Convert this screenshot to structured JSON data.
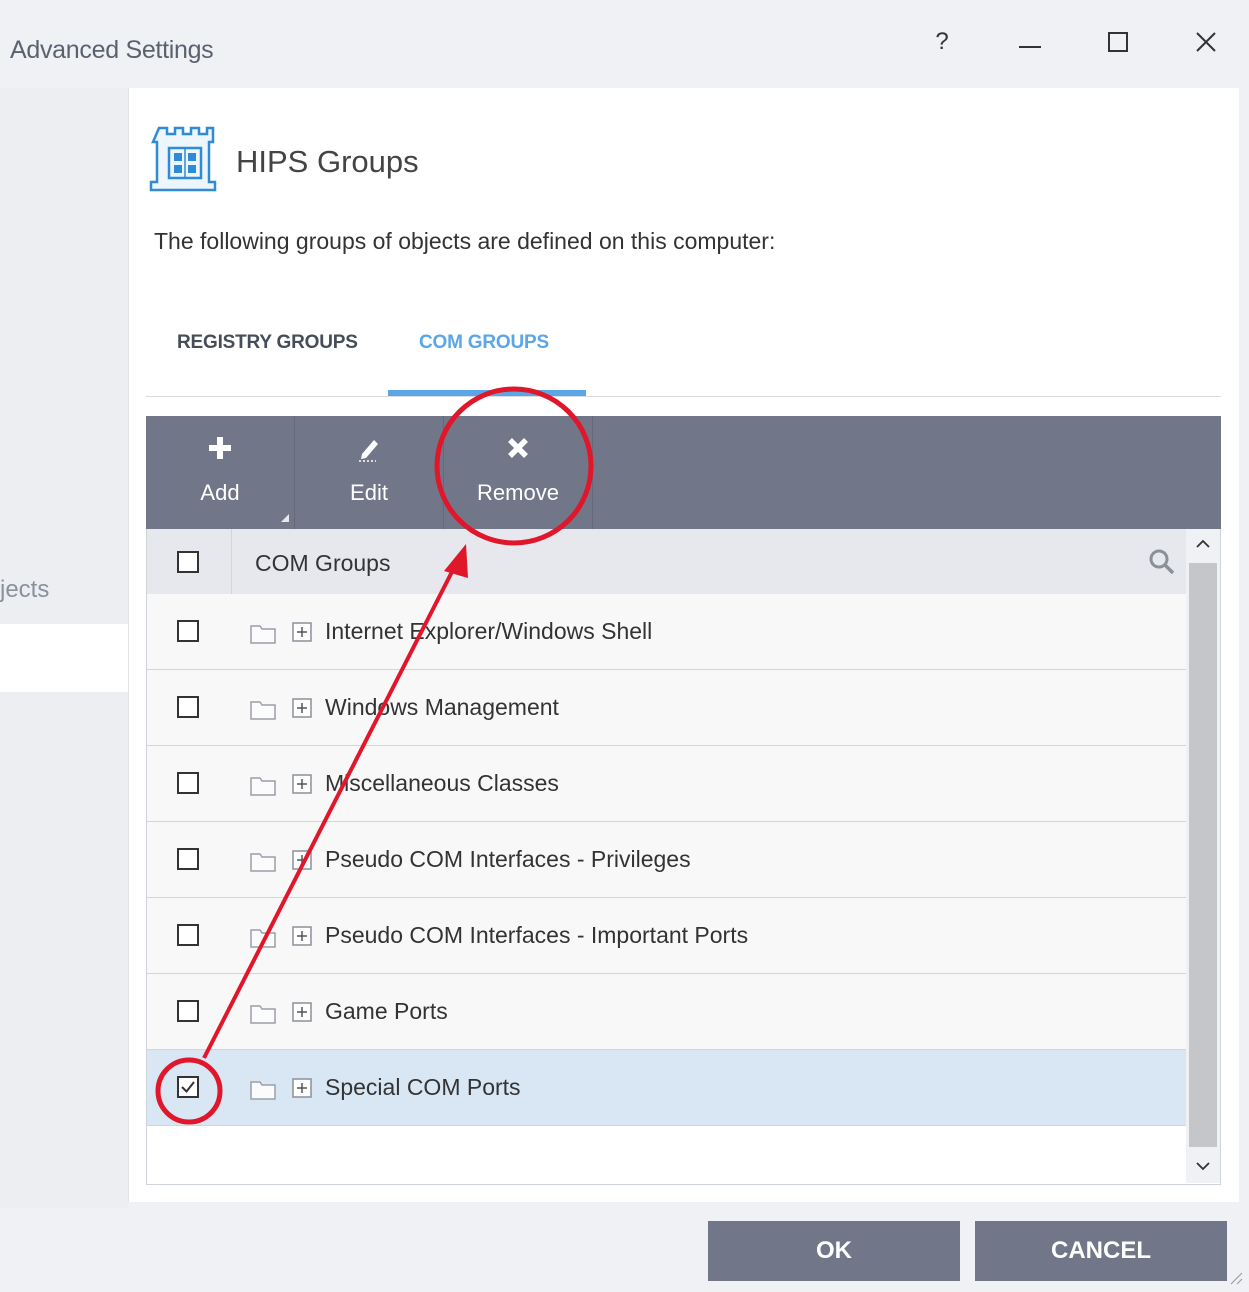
{
  "window": {
    "title": "Advanced Settings",
    "help_label": "?"
  },
  "sidebar": {
    "objects_label": "jects"
  },
  "panel": {
    "title": "HIPS Groups",
    "description": "The following groups of objects are defined on this computer:"
  },
  "tabs": [
    {
      "label": "REGISTRY GROUPS",
      "active": false
    },
    {
      "label": "COM GROUPS",
      "active": true
    }
  ],
  "toolbar": {
    "add_label": "Add",
    "edit_label": "Edit",
    "remove_label": "Remove"
  },
  "table": {
    "header": "COM Groups",
    "rows": [
      {
        "label": "Internet Explorer/Windows Shell",
        "checked": false
      },
      {
        "label": "Windows Management",
        "checked": false
      },
      {
        "label": "Miscellaneous Classes",
        "checked": false
      },
      {
        "label": "Pseudo COM Interfaces - Privileges",
        "checked": false
      },
      {
        "label": "Pseudo COM Interfaces - Important Ports",
        "checked": false
      },
      {
        "label": "Game Ports",
        "checked": false
      },
      {
        "label": "Special COM Ports",
        "checked": true
      }
    ]
  },
  "footer": {
    "ok_label": "OK",
    "cancel_label": "CANCEL"
  },
  "colors": {
    "accent": "#5aa6e6",
    "toolbar": "#717788",
    "selected_row": "#d9e7f5",
    "annotation": "#e0162b"
  }
}
